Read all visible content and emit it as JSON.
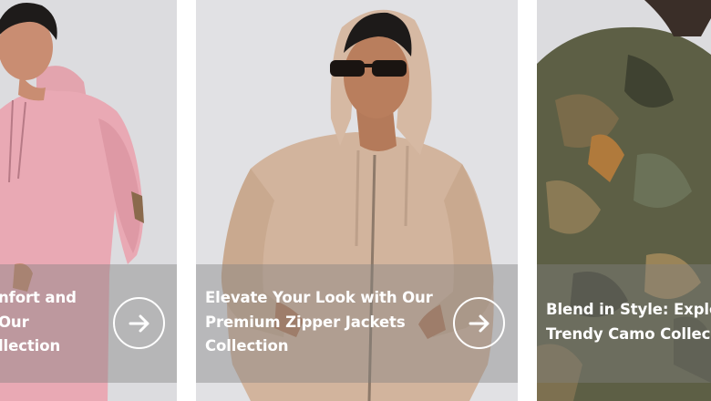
{
  "cards": [
    {
      "title_lines": [
        "nfort and",
        "Our",
        "llection"
      ],
      "icon": "arrow-right-icon",
      "image_subject": "model-pink-hoodie"
    },
    {
      "title_lines": [
        "Elevate Your Look with Our",
        "Premium Zipper Jackets",
        "Collection"
      ],
      "icon": "arrow-right-icon",
      "image_subject": "model-beige-zipper-hoodie"
    },
    {
      "title_lines": [
        "Blend in Style: Explo",
        "Trendy Camo Collec"
      ],
      "image_subject": "model-camo-hoodie"
    }
  ],
  "colors": {
    "overlay": "#808080",
    "caption_text": "#ffffff",
    "pink_hoodie": "#e9a9b4",
    "beige_hoodie": "#d2b49d",
    "camo_base": "#5d5f45"
  }
}
